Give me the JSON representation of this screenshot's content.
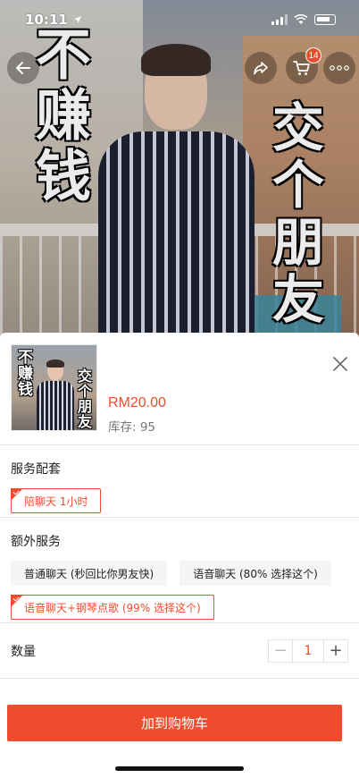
{
  "status_bar": {
    "time": "10:11"
  },
  "hero": {
    "caption_left": "不赚钱",
    "caption_right": "交个朋友"
  },
  "nav": {
    "cart_count": "14"
  },
  "product": {
    "thumb_caption_left": "不赚钱",
    "thumb_caption_right": "交个朋友",
    "price": "RM20.00",
    "stock": "库存: 95"
  },
  "service_package": {
    "title": "服务配套",
    "options": [
      {
        "label": "陪聊天 1小时",
        "selected": true
      }
    ]
  },
  "extra_service": {
    "title": "额外服务",
    "options": [
      {
        "label": "普通聊天 (秒回比你男友快)",
        "selected": false
      },
      {
        "label": "语音聊天 (80% 选择这个)",
        "selected": false
      },
      {
        "label": "语音聊天+钢琴点歌 (99% 选择这个)",
        "selected": true
      }
    ]
  },
  "quantity": {
    "label": "数量",
    "value": "1",
    "minus": "−",
    "plus": "+"
  },
  "cta": {
    "label": "加到购物车"
  },
  "colors": {
    "accent": "#ee4d2d"
  }
}
